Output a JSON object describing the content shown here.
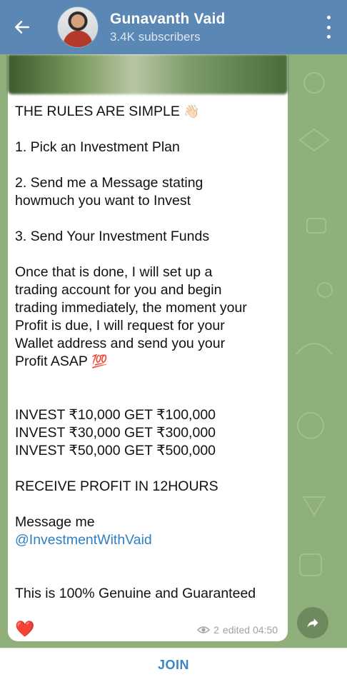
{
  "header": {
    "title": "Gunavanth Vaid",
    "subtitle": "3.4K subscribers",
    "back_icon": "back-arrow-icon",
    "menu_icon": "more-vertical-icon"
  },
  "message": {
    "line_rules": "THE RULES ARE SIMPLE",
    "emoji_wave": "👋🏻",
    "step1": "1. Pick an Investment Plan",
    "step2_a": "2. Send me a Message stating",
    "step2_b": "howmuch you want to Invest",
    "step3": "3. Send Your Investment Funds",
    "para": [
      "Once that is done, I will set up a",
      "trading account for you and begin",
      "trading immediately, the moment your",
      "Profit is due, I will request for your",
      "Wallet address and send you your"
    ],
    "para_last": "Profit ASAP",
    "emoji_100": "💯",
    "invest": [
      "INVEST ₹10,000 GET ₹100,000",
      "INVEST ₹30,000 GET ₹300,000",
      "INVEST ₹50,000 GET ₹500,000"
    ],
    "receive": "RECEIVE PROFIT IN 12HOURS",
    "message_me": "Message me",
    "handle": "@InvestmentWithVaid",
    "genuine": "This is 100% Genuine and Guaranteed",
    "reaction": "❤️",
    "views": "2",
    "edited": "edited 04:50"
  },
  "footer": {
    "join_label": "JOIN"
  },
  "colors": {
    "header_bg": "#5a87b3",
    "link": "#2e7fc4",
    "chat_bg": "#8fb07a"
  }
}
